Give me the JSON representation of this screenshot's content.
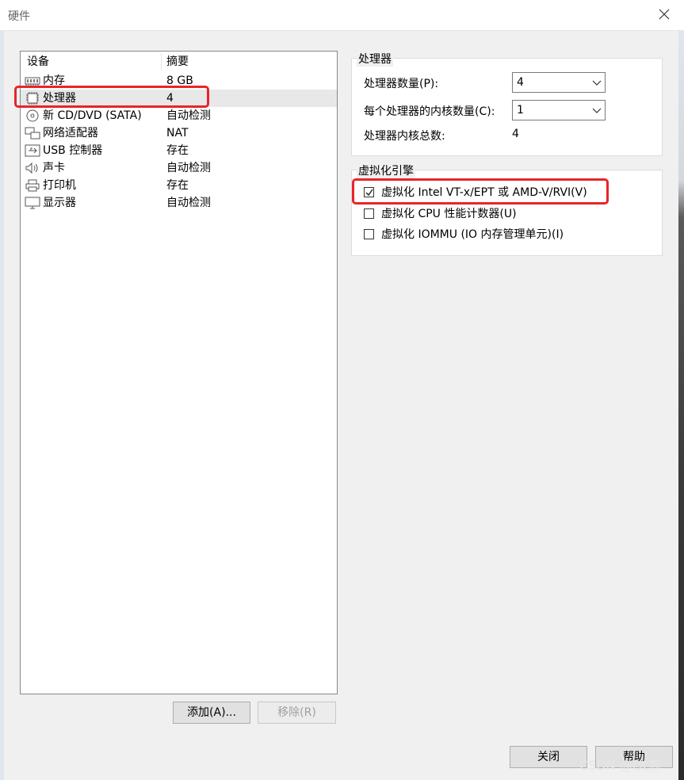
{
  "window": {
    "title": "硬件"
  },
  "device_list": {
    "col_device": "设备",
    "col_summary": "摘要",
    "rows": [
      {
        "name": "内存",
        "summary": "8 GB",
        "icon": "memory-icon"
      },
      {
        "name": "处理器",
        "summary": "4",
        "icon": "cpu-icon",
        "selected": true
      },
      {
        "name": "新 CD/DVD (SATA)",
        "summary": "自动检测",
        "icon": "cd-dvd-icon"
      },
      {
        "name": "网络适配器",
        "summary": "NAT",
        "icon": "network-icon"
      },
      {
        "name": "USB 控制器",
        "summary": "存在",
        "icon": "usb-icon"
      },
      {
        "name": "声卡",
        "summary": "自动检测",
        "icon": "speaker-icon"
      },
      {
        "name": "打印机",
        "summary": "存在",
        "icon": "printer-icon"
      },
      {
        "name": "显示器",
        "summary": "自动检测",
        "icon": "monitor-icon"
      }
    ],
    "add_label": "添加(A)...",
    "remove_label": "移除(R)"
  },
  "processor_group": {
    "title": "处理器",
    "count_label": "处理器数量(P):",
    "count_value": "4",
    "cores_label": "每个处理器的内核数量(C):",
    "cores_value": "1",
    "total_label": "处理器内核总数:",
    "total_value": "4"
  },
  "virtualization_group": {
    "title": "虚拟化引擎",
    "options": [
      {
        "label": "虚拟化 Intel VT-x/EPT 或 AMD-V/RVI(V)",
        "checked": true
      },
      {
        "label": "虚拟化 CPU 性能计数器(U)",
        "checked": false
      },
      {
        "label": "虚拟化 IOMMU (IO 内存管理单元)(I)",
        "checked": false
      }
    ]
  },
  "footer": {
    "close_label": "关闭",
    "help_label": "帮助"
  },
  "watermark": "CSDN @I大熊",
  "colors": {
    "highlight": "#e8252a",
    "selection": "#e8e8e8"
  }
}
